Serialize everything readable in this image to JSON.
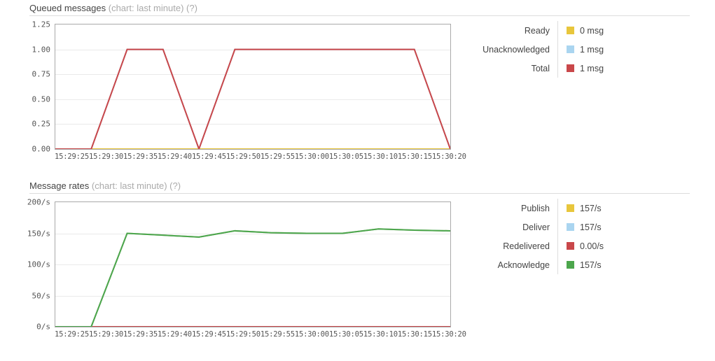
{
  "sections": [
    {
      "title_main": "Queued messages",
      "title_sub": "(chart: last minute)",
      "title_help": "(?)",
      "legend": [
        {
          "label": "Ready",
          "value": "0 msg",
          "color": "#e8c63c"
        },
        {
          "label": "Unacknowledged",
          "value": "1 msg",
          "color": "#aad5f0"
        },
        {
          "label": "Total",
          "value": "1 msg",
          "color": "#c9474a"
        }
      ],
      "chart_data": {
        "type": "line",
        "title": "Queued messages (chart: last minute)",
        "xlabel": "",
        "ylabel": "",
        "ylim": [
          0,
          1.25
        ],
        "yticks": [
          "0.00",
          "0.25",
          "0.50",
          "0.75",
          "1.00",
          "1.25"
        ],
        "ytick_values": [
          0,
          0.25,
          0.5,
          0.75,
          1.0,
          1.25
        ],
        "grid": true,
        "legend_position": "right",
        "x": [
          "15:29:25",
          "15:29:30",
          "15:29:35",
          "15:29:40",
          "15:29:45",
          "15:29:50",
          "15:29:55",
          "15:30:00",
          "15:30:05",
          "15:30:10",
          "15:30:15",
          "15:30:20"
        ],
        "series": [
          {
            "name": "Ready",
            "color": "#e8c63c",
            "values": [
              0,
              0,
              0,
              0,
              0,
              0,
              0,
              0,
              0,
              0,
              0,
              0
            ]
          },
          {
            "name": "Unacknowledged",
            "color": "#aad5f0",
            "values": [
              0,
              0,
              1,
              1,
              0,
              1,
              1,
              1,
              1,
              1,
              1,
              0
            ]
          },
          {
            "name": "Total",
            "color": "#c9474a",
            "values": [
              0,
              0,
              1,
              1,
              0,
              1,
              1,
              1,
              1,
              1,
              1,
              0
            ]
          }
        ]
      }
    },
    {
      "title_main": "Message rates",
      "title_sub": "(chart: last minute)",
      "title_help": "(?)",
      "legend": [
        {
          "label": "Publish",
          "value": "157/s",
          "color": "#e8c63c"
        },
        {
          "label": "Deliver",
          "value": "157/s",
          "color": "#aad5f0"
        },
        {
          "label": "Redelivered",
          "value": "0.00/s",
          "color": "#c9474a"
        },
        {
          "label": "Acknowledge",
          "value": "157/s",
          "color": "#4ca64c"
        }
      ],
      "chart_data": {
        "type": "line",
        "title": "Message rates (chart: last minute)",
        "xlabel": "",
        "ylabel": "",
        "ylim": [
          0,
          200
        ],
        "yticks": [
          "0/s",
          "50/s",
          "100/s",
          "150/s",
          "200/s"
        ],
        "ytick_values": [
          0,
          50,
          100,
          150,
          200
        ],
        "grid": true,
        "legend_position": "right",
        "x": [
          "15:29:25",
          "15:29:30",
          "15:29:35",
          "15:29:40",
          "15:29:45",
          "15:29:50",
          "15:29:55",
          "15:30:00",
          "15:30:05",
          "15:30:10",
          "15:30:15",
          "15:30:20"
        ],
        "series": [
          {
            "name": "Publish",
            "color": "#e8c63c",
            "values": [
              0,
              0,
              150,
              147,
              144,
              154,
              151,
              150,
              150,
              157,
              155,
              154
            ]
          },
          {
            "name": "Deliver",
            "color": "#aad5f0",
            "values": [
              0,
              0,
              150,
              147,
              144,
              154,
              151,
              150,
              150,
              157,
              155,
              154
            ]
          },
          {
            "name": "Redelivered",
            "color": "#c9474a",
            "values": [
              0,
              0,
              0,
              0,
              0,
              0,
              0,
              0,
              0,
              0,
              0,
              0
            ]
          },
          {
            "name": "Acknowledge",
            "color": "#4ca64c",
            "values": [
              0,
              0,
              150,
              147,
              144,
              154,
              151,
              150,
              150,
              157,
              155,
              154
            ]
          }
        ]
      }
    }
  ]
}
